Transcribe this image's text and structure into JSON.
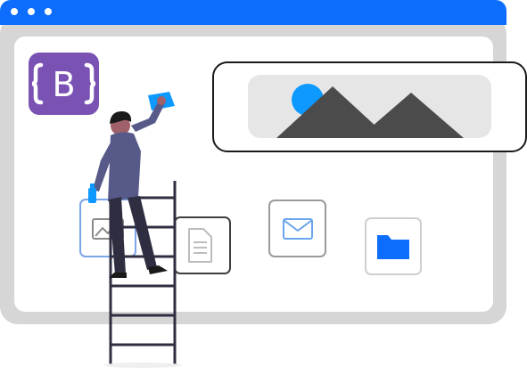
{
  "illustration": {
    "logo_letter": "B",
    "colors": {
      "accent": "#0d6efd",
      "brand": "#7952b3",
      "window_frame": "#d6d6d6",
      "panel_bg": "#e6e6e6",
      "mountain": "#4b4b4b",
      "sun": "#0d99ff",
      "tile_outline": "#cfcfcf",
      "figure_shirt": "#575a89",
      "figure_pants": "#2f2e41",
      "figure_skin": "#a0616a",
      "cloth": "#0d99ff"
    },
    "icons": [
      "browser-window-icon",
      "bootstrap-logo-icon",
      "image-placeholder-icon",
      "small-image-icon",
      "document-icon",
      "mail-icon",
      "folder-icon",
      "ladder-icon",
      "person-cleaning-icon"
    ]
  }
}
